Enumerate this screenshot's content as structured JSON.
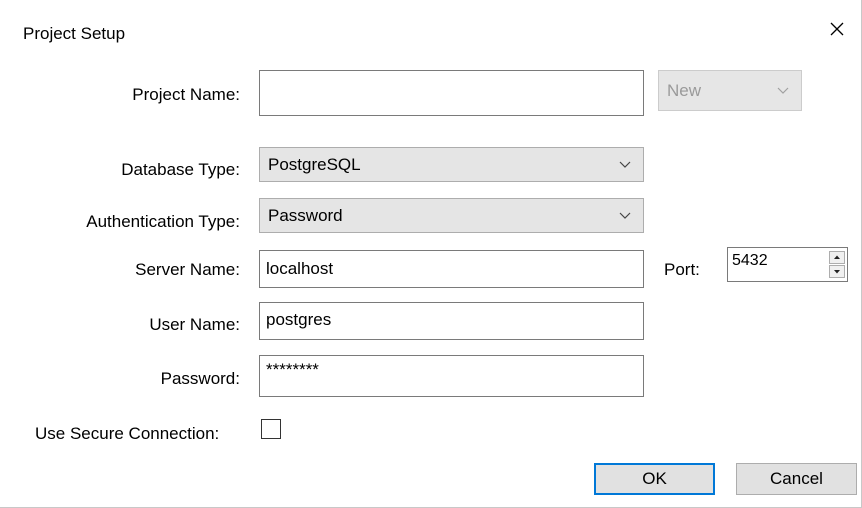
{
  "dialog": {
    "title": "Project Setup",
    "close_glyph": "✕"
  },
  "form": {
    "project_name": {
      "label": "Project Name:",
      "value": "",
      "selector_value": "New",
      "selector_disabled": true
    },
    "database_type": {
      "label": "Database Type:",
      "value": "PostgreSQL"
    },
    "authentication_type": {
      "label": "Authentication Type:",
      "value": "Password"
    },
    "server_name": {
      "label": "Server Name:",
      "value": "localhost"
    },
    "port": {
      "label": "Port:",
      "value": "5432"
    },
    "user_name": {
      "label": "User Name:",
      "value": "postgres"
    },
    "password": {
      "label": "Password:",
      "value": "********"
    },
    "secure_connection": {
      "label": "Use Secure Connection:",
      "checked": false
    }
  },
  "buttons": {
    "ok_label": "OK",
    "cancel_label": "Cancel"
  },
  "colors": {
    "accent": "#0078d7",
    "combo_bg": "#e5e5e5",
    "button_bg": "#e1e1e1"
  },
  "icons": {
    "close": "close-icon",
    "dropdown": "chevron-down-icon",
    "spin_up": "arrow-up-icon",
    "spin_down": "arrow-down-icon"
  }
}
